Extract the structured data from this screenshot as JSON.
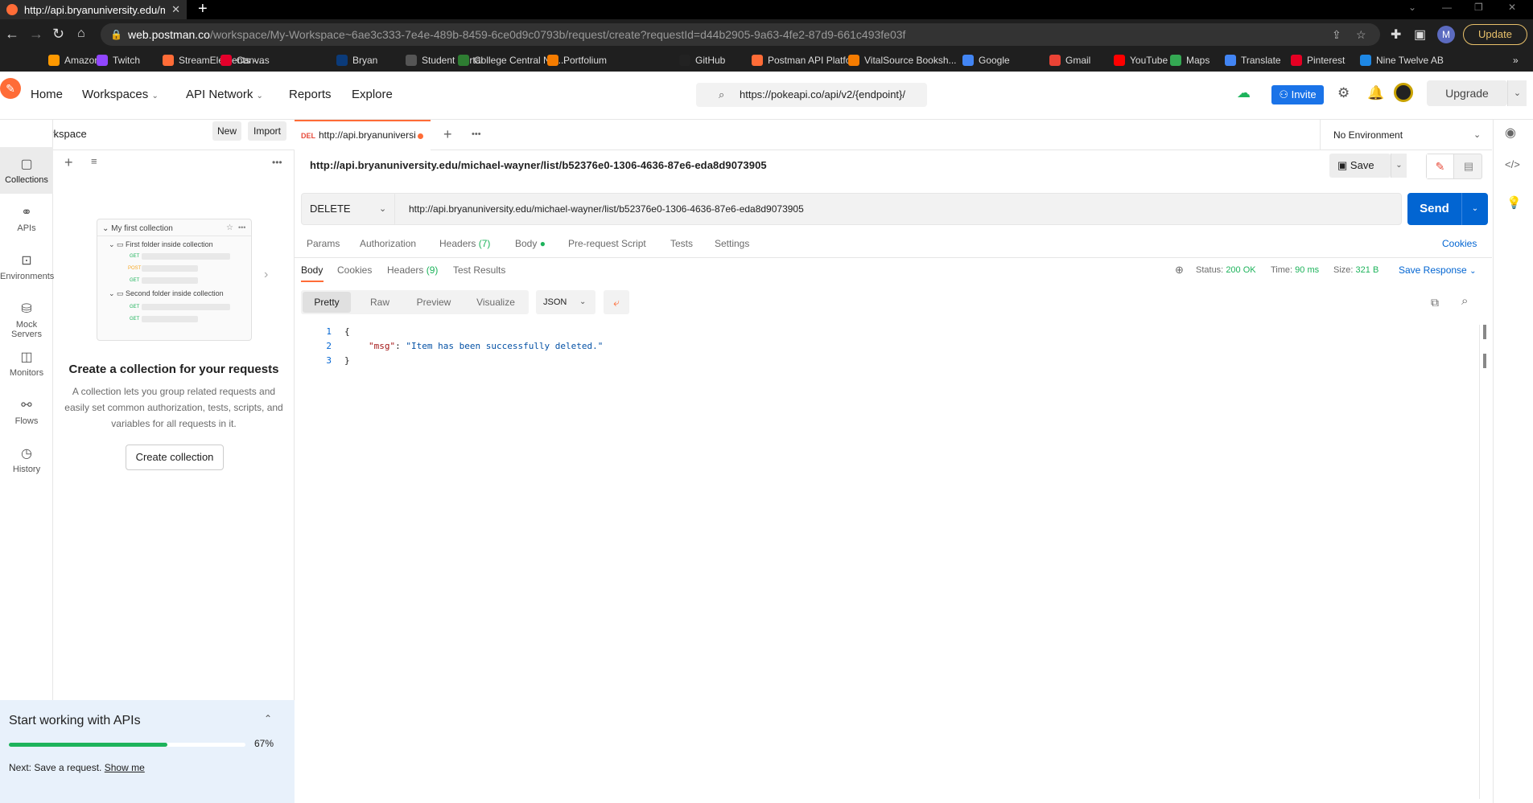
{
  "browser": {
    "tab_title": "http://api.bryanuniversity.edu/m",
    "url_domain": "web.postman.co",
    "url_path": "/workspace/My-Workspace~6ae3c333-7e4e-489b-8459-6ce0d9c0793b/request/create?requestId=d44b2905-9a63-4fe2-87d9-661c493fe03f",
    "profile_initial": "M",
    "update_label": "Update",
    "bookmarks": [
      {
        "label": "Amazon",
        "color": "#ff9900"
      },
      {
        "label": "Twitch",
        "color": "#9146ff"
      },
      {
        "label": "StreamElements -...",
        "color": "#ff6c37"
      },
      {
        "label": "Canvas",
        "color": "#e4002b"
      },
      {
        "label": "Bryan",
        "color": "#0b3b7a"
      },
      {
        "label": "Student Portal",
        "color": "#555555"
      },
      {
        "label": "College Central Net...",
        "color": "#2e7d32"
      },
      {
        "label": "Portfolium",
        "color": "#f57c00"
      },
      {
        "label": "GitHub",
        "color": "#222222"
      },
      {
        "label": "Postman API Platfo...",
        "color": "#ff6c37"
      },
      {
        "label": "VitalSource Booksh...",
        "color": "#f57c00"
      },
      {
        "label": "Google",
        "color": "#4285f4"
      },
      {
        "label": "Gmail",
        "color": "#ea4335"
      },
      {
        "label": "YouTube",
        "color": "#ff0000"
      },
      {
        "label": "Maps",
        "color": "#34a853"
      },
      {
        "label": "Translate",
        "color": "#4285f4"
      },
      {
        "label": "Pinterest",
        "color": "#e60023"
      },
      {
        "label": "Nine Twelve AB",
        "color": "#1e88e5"
      }
    ]
  },
  "header": {
    "nav": [
      "Home",
      "Workspaces",
      "API Network",
      "Reports",
      "Explore"
    ],
    "search_value": "https://pokeapi.co/api/v2/{endpoint}/",
    "invite_label": "Invite",
    "upgrade_label": "Upgrade"
  },
  "sidebar": {
    "workspace_name": "My Workspace",
    "new_label": "New",
    "import_label": "Import",
    "rail": [
      "Collections",
      "APIs",
      "Environments",
      "Mock Servers",
      "Monitors",
      "Flows",
      "History"
    ],
    "preview": {
      "collection": "My first collection",
      "folder1": "First folder inside collection",
      "folder2": "Second folder inside collection",
      "methods": [
        "GET",
        "POST",
        "GET",
        "GET",
        "GET"
      ]
    },
    "empty_title": "Create a collection for your requests",
    "empty_desc": "A collection lets you group related requests and easily set common authorization, tests, scripts, and variables for all requests in it.",
    "create_label": "Create collection",
    "onboarding": {
      "title": "Start working with APIs",
      "progress": 0.67,
      "progress_label": "67%",
      "next_text": "Next: Save a request.",
      "show_me": "Show me"
    }
  },
  "request": {
    "tab_method": "DEL",
    "tab_title": "http://api.bryanuniversi",
    "environment": "No Environment",
    "name": "http://api.bryanuniversity.edu/michael-wayner/list/b52376e0-1306-4636-87e6-eda8d9073905",
    "save_label": "Save",
    "method": "DELETE",
    "url": "http://api.bryanuniversity.edu/michael-wayner/list/b52376e0-1306-4636-87e6-eda8d9073905",
    "send_label": "Send",
    "tabs": [
      "Params",
      "Authorization",
      "Headers",
      "Body",
      "Pre-request Script",
      "Tests",
      "Settings"
    ],
    "headers_count": "(7)",
    "cookies_label": "Cookies"
  },
  "response": {
    "tabs": [
      "Body",
      "Cookies",
      "Headers",
      "Test Results"
    ],
    "headers_count": "(9)",
    "status_label": "Status:",
    "status_value": "200 OK",
    "time_label": "Time:",
    "time_value": "90 ms",
    "size_label": "Size:",
    "size_value": "321 B",
    "save_response": "Save Response",
    "views": [
      "Pretty",
      "Raw",
      "Preview",
      "Visualize"
    ],
    "format": "JSON",
    "lines": [
      "1",
      "2",
      "3"
    ],
    "code_open": "{",
    "code_key": "\"msg\"",
    "code_value": "\"Item has been successfully deleted.\"",
    "code_close": "}"
  }
}
